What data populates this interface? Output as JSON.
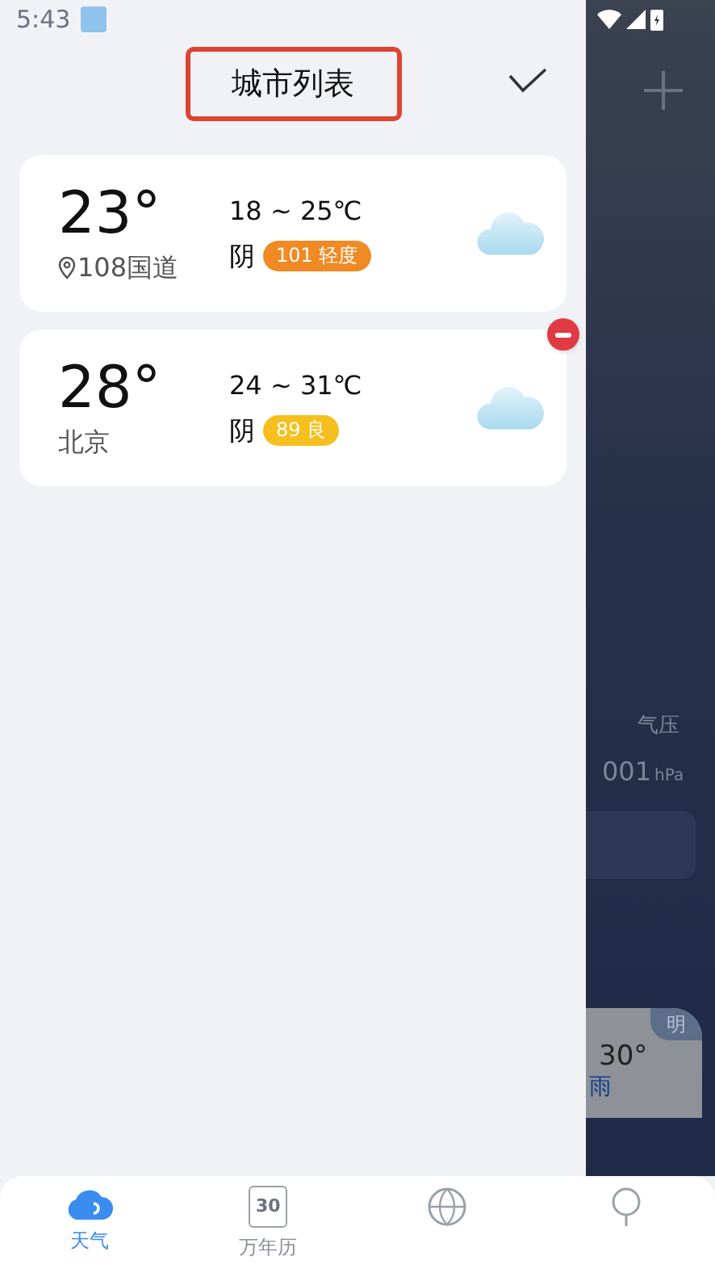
{
  "status_bar": {
    "time": "5:43"
  },
  "drawer": {
    "title": "城市列表",
    "title_highlighted": true
  },
  "cities": [
    {
      "temp": "23°",
      "location": "108国道",
      "located": true,
      "range": "18 ~ 25℃",
      "weather": "阴",
      "aqi": "101 轻度",
      "color": "#f08a24",
      "removable": false
    },
    {
      "temp": "28°",
      "location": "北京",
      "located": false,
      "range": "24 ~ 31℃",
      "weather": "阴",
      "aqi": "89 良",
      "color": "#f5c01d",
      "removable": true
    }
  ],
  "background_page": {
    "pressure_label": "气压",
    "pressure_value": "001",
    "pressure_unit": "hPa",
    "forecast_badge": "明",
    "forecast_temp": "30°",
    "forecast_weather": "雨"
  },
  "tabs": [
    {
      "label": "天气",
      "selected": true,
      "kind": "weather"
    },
    {
      "label": "万年历",
      "icon_text": "30",
      "selected": false,
      "kind": "calendar"
    },
    {
      "selected": false,
      "kind": "almanac"
    },
    {
      "selected": false,
      "kind": "tools"
    }
  ]
}
